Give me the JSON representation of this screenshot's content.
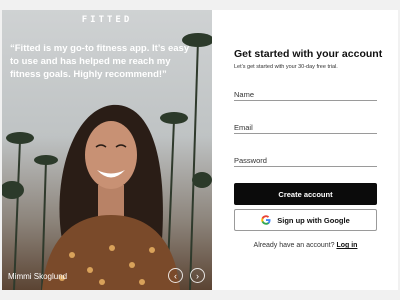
{
  "brand": {
    "logo_text": "FITTED"
  },
  "testimonial": {
    "quote": "“Fitted is my go-to fitness app. It’s easy to use and has helped me reach my fitness goals. Highly recommend!”",
    "author": "Mimmi Skoglund",
    "prev_icon": "chevron-left-icon",
    "next_icon": "chevron-right-icon",
    "prev_glyph": "‹",
    "next_glyph": "›"
  },
  "form": {
    "title": "Get started with your account",
    "subtitle": "Let’s get started with your 30-day free trial.",
    "name_placeholder": "Name",
    "email_placeholder": "Email",
    "password_placeholder": "Password",
    "create_label": "Create account",
    "google_label": "Sign up with Google",
    "google_icon": "google-icon",
    "login_prompt": "Already have an account?",
    "login_link": "Log in"
  },
  "colors": {
    "page_bg": "#f1f1f1",
    "card_bg": "#ffffff",
    "primary_button": "#0b0b0b",
    "text": "#111111"
  }
}
